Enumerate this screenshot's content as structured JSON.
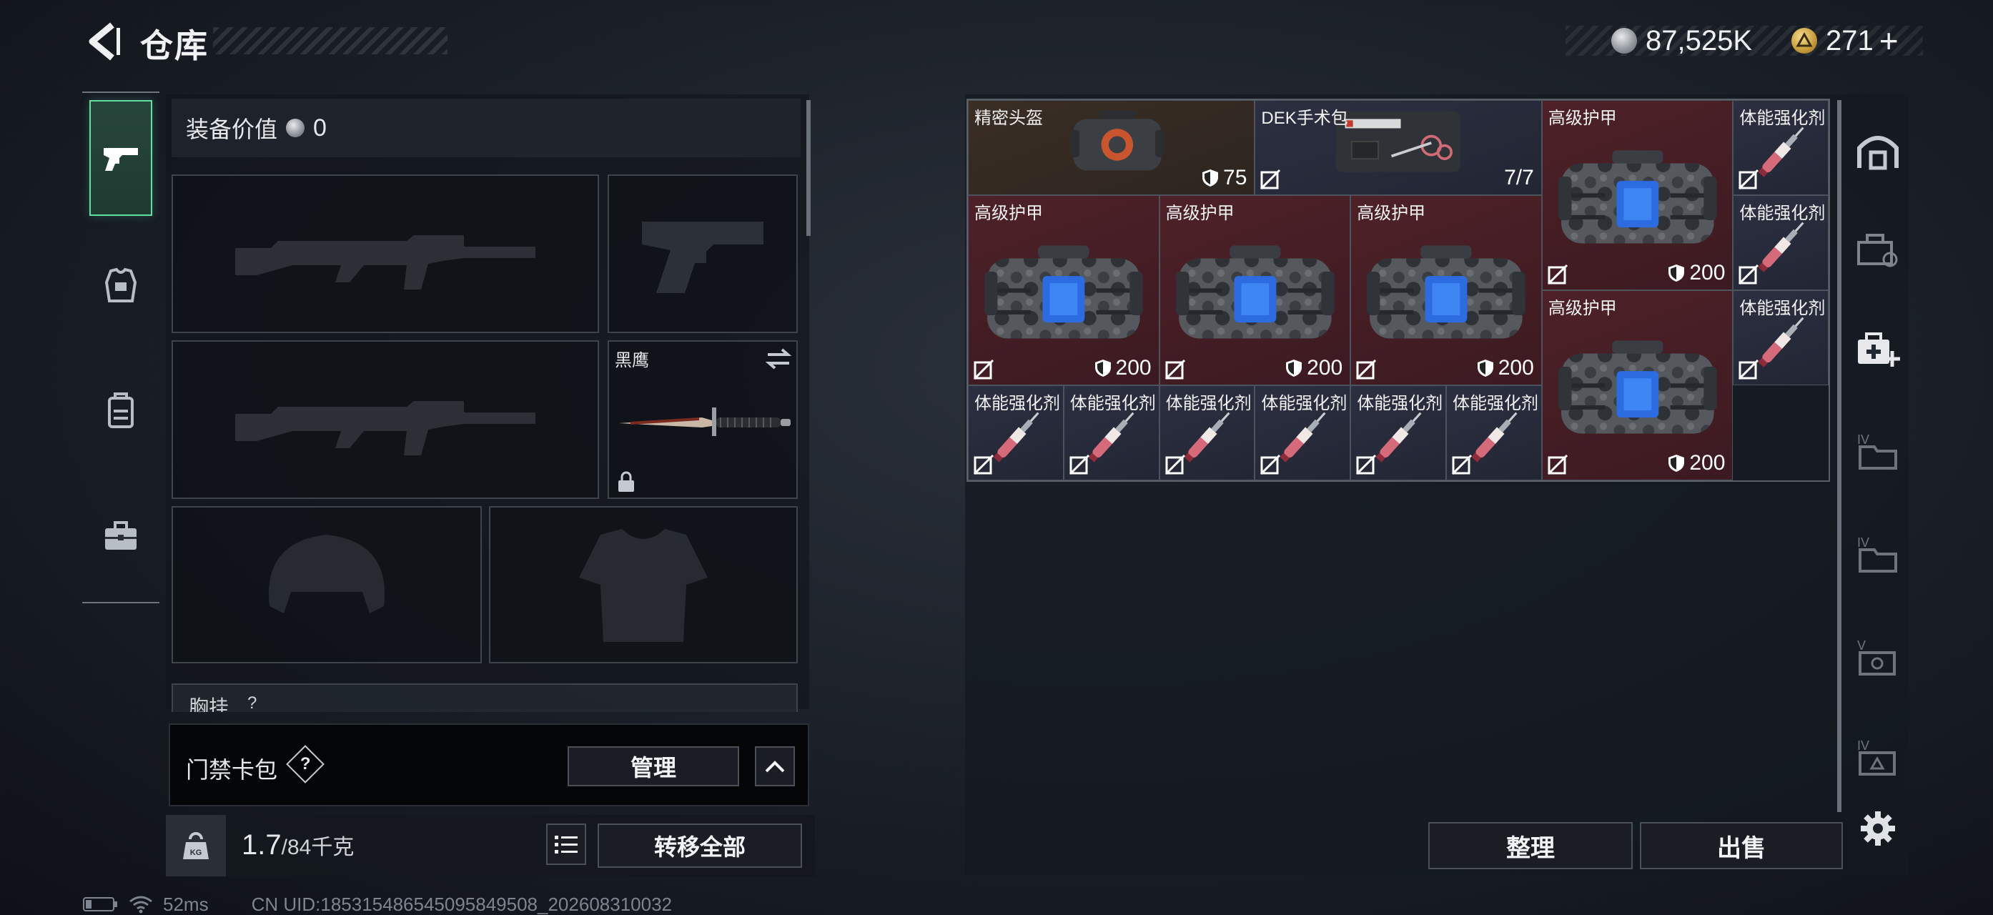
{
  "header": {
    "title": "仓库",
    "currency_silver": "87,525K",
    "currency_gold": "271",
    "gold_add": "+"
  },
  "loadout": {
    "equip_value_label": "装备价值",
    "equip_value": "0",
    "melee_name": "黑鹰",
    "chest_rig_label": "胸挂",
    "chest_rig_help": "?"
  },
  "keycard": {
    "label": "门禁卡包",
    "help": "?",
    "manage_button": "管理"
  },
  "weight": {
    "current": "1.7",
    "max": "/84千克",
    "kg_badge": "KG"
  },
  "actions": {
    "transfer_all": "转移全部",
    "organize": "整理",
    "sell": "出售"
  },
  "items": [
    {
      "name": "精密头盔",
      "durability": "75",
      "bg": "brown"
    },
    {
      "name": "DEK手术包",
      "uses": "7/7",
      "bg": "navy"
    },
    {
      "name": "高级护甲",
      "durability": "200",
      "bg": "red"
    },
    {
      "name": "体能强化剂",
      "bg": "navy"
    },
    {
      "name": "高级护甲",
      "durability": "200",
      "bg": "red"
    },
    {
      "name": "高级护甲",
      "durability": "200",
      "bg": "red"
    },
    {
      "name": "高级护甲",
      "durability": "200",
      "bg": "red"
    },
    {
      "name": "体能强化剂",
      "bg": "navy"
    },
    {
      "name": "高级护甲",
      "durability": "200",
      "bg": "red"
    },
    {
      "name": "体能强化剂",
      "bg": "navy"
    },
    {
      "name": "体能强化剂",
      "bg": "navy"
    },
    {
      "name": "体能强化剂",
      "bg": "navy"
    },
    {
      "name": "体能强化剂",
      "bg": "navy"
    },
    {
      "name": "体能强化剂",
      "bg": "navy"
    },
    {
      "name": "体能强化剂",
      "bg": "navy"
    },
    {
      "name": "体能强化剂",
      "bg": "navy"
    }
  ],
  "status": {
    "ping": "52ms",
    "uid": "CN UID:18531548654509584​9508_202608310032"
  },
  "colors": {
    "accent_green": "#5ee0a5",
    "rare_red": "#4e2128",
    "navy": "#2b2f40"
  }
}
